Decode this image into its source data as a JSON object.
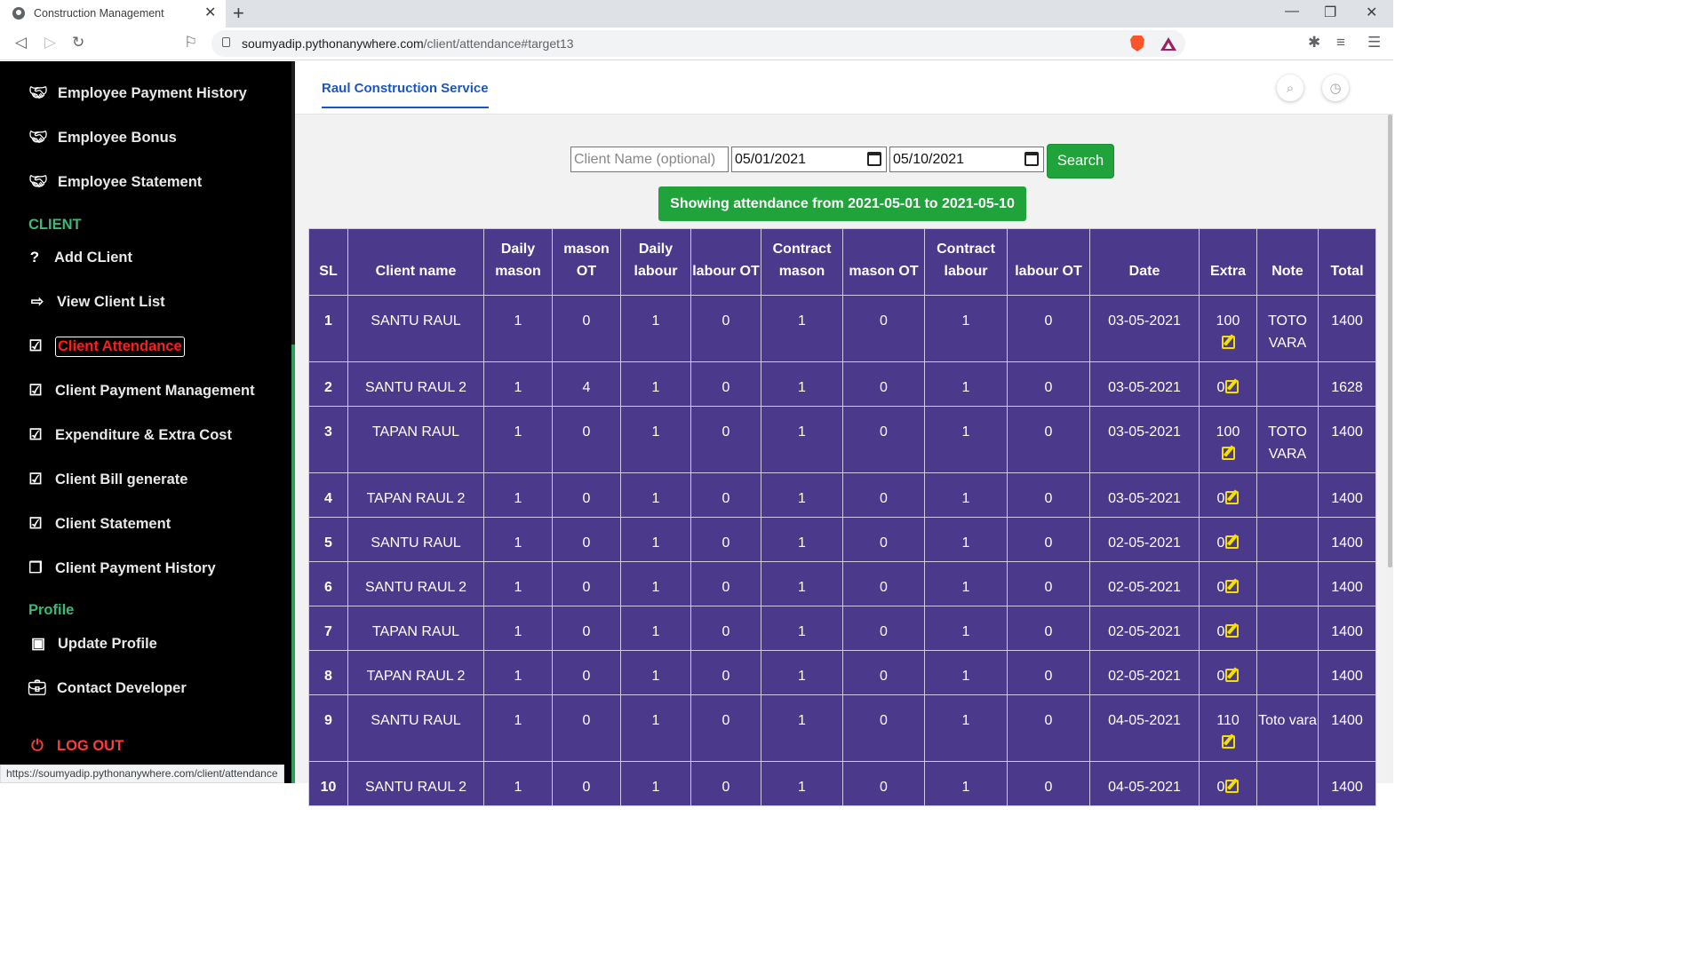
{
  "browser": {
    "tab_title": "Construction Management",
    "url_host": "soumyadip.pythonanywhere.com",
    "url_path": "/client/attendance#target13",
    "status_url": "https://soumyadip.pythonanywhere.com/client/attendance"
  },
  "sidebar": {
    "items_top": [
      {
        "label": "Employee Payment History",
        "icon": "handshake-icon"
      },
      {
        "label": "Employee Bonus",
        "icon": "handshake-icon"
      },
      {
        "label": "Employee Statement",
        "icon": "handshake-icon"
      }
    ],
    "section_client": "CLIENT",
    "client_items": [
      {
        "label": "Add CLient",
        "icon": "question-icon"
      },
      {
        "label": "View Client List",
        "icon": "sign-in-icon"
      },
      {
        "label": "Client Attendance",
        "icon": "calendar-check-icon",
        "active": true
      },
      {
        "label": "Client Payment Management",
        "icon": "calendar-check-icon"
      },
      {
        "label": "Expenditure & Extra Cost",
        "icon": "calendar-check-icon"
      },
      {
        "label": "Client Bill generate",
        "icon": "calendar-check-icon"
      },
      {
        "label": "Client Statement",
        "icon": "calendar-check-icon"
      },
      {
        "label": "Client Payment History",
        "icon": "copy-icon"
      }
    ],
    "section_profile": "Profile",
    "profile_items": [
      {
        "label": "Update Profile",
        "icon": "money-bill-icon"
      },
      {
        "label": "Contact Developer",
        "icon": "briefcase-icon"
      }
    ],
    "logout": "LOG OUT"
  },
  "header": {
    "brand": "Raul Construction Service"
  },
  "filters": {
    "client_placeholder": "Client Name (optional)",
    "from_date": "05/01/2021",
    "to_date": "05/10/2021",
    "search_label": "Search"
  },
  "banner": "Showing attendance from 2021-05-01 to 2021-05-10",
  "table": {
    "columns": [
      "SL",
      "Client name",
      "Daily mason",
      "mason OT",
      "Daily labour",
      "labour OT",
      "Contract mason",
      "mason OT",
      "Contract labour",
      "labour OT",
      "Date",
      "Extra",
      "Note",
      "Total"
    ],
    "rows": [
      {
        "sl": "1",
        "client": "SANTU RAUL",
        "dm": "1",
        "mot": "0",
        "dl": "1",
        "lot": "0",
        "cm": "1",
        "cmot": "0",
        "cl": "1",
        "clot": "0",
        "date": "03-05-2021",
        "extra": "100",
        "note": "TOTO VARA",
        "total": "1400"
      },
      {
        "sl": "2",
        "client": "SANTU RAUL 2",
        "dm": "1",
        "mot": "4",
        "dl": "1",
        "lot": "0",
        "cm": "1",
        "cmot": "0",
        "cl": "1",
        "clot": "0",
        "date": "03-05-2021",
        "extra": "0",
        "note": "",
        "total": "1628"
      },
      {
        "sl": "3",
        "client": "TAPAN RAUL",
        "dm": "1",
        "mot": "0",
        "dl": "1",
        "lot": "0",
        "cm": "1",
        "cmot": "0",
        "cl": "1",
        "clot": "0",
        "date": "03-05-2021",
        "extra": "100",
        "note": "TOTO VARA",
        "total": "1400"
      },
      {
        "sl": "4",
        "client": "TAPAN RAUL 2",
        "dm": "1",
        "mot": "0",
        "dl": "1",
        "lot": "0",
        "cm": "1",
        "cmot": "0",
        "cl": "1",
        "clot": "0",
        "date": "03-05-2021",
        "extra": "0",
        "note": "",
        "total": "1400"
      },
      {
        "sl": "5",
        "client": "SANTU RAUL",
        "dm": "1",
        "mot": "0",
        "dl": "1",
        "lot": "0",
        "cm": "1",
        "cmot": "0",
        "cl": "1",
        "clot": "0",
        "date": "02-05-2021",
        "extra": "0",
        "note": "",
        "total": "1400"
      },
      {
        "sl": "6",
        "client": "SANTU RAUL 2",
        "dm": "1",
        "mot": "0",
        "dl": "1",
        "lot": "0",
        "cm": "1",
        "cmot": "0",
        "cl": "1",
        "clot": "0",
        "date": "02-05-2021",
        "extra": "0",
        "note": "",
        "total": "1400"
      },
      {
        "sl": "7",
        "client": "TAPAN RAUL",
        "dm": "1",
        "mot": "0",
        "dl": "1",
        "lot": "0",
        "cm": "1",
        "cmot": "0",
        "cl": "1",
        "clot": "0",
        "date": "02-05-2021",
        "extra": "0",
        "note": "",
        "total": "1400"
      },
      {
        "sl": "8",
        "client": "TAPAN RAUL 2",
        "dm": "1",
        "mot": "0",
        "dl": "1",
        "lot": "0",
        "cm": "1",
        "cmot": "0",
        "cl": "1",
        "clot": "0",
        "date": "02-05-2021",
        "extra": "0",
        "note": "",
        "total": "1400"
      },
      {
        "sl": "9",
        "client": "SANTU RAUL",
        "dm": "1",
        "mot": "0",
        "dl": "1",
        "lot": "0",
        "cm": "1",
        "cmot": "0",
        "cl": "1",
        "clot": "0",
        "date": "04-05-2021",
        "extra": "110",
        "note": "Toto vara",
        "total": "1400"
      },
      {
        "sl": "10",
        "client": "SANTU RAUL 2",
        "dm": "1",
        "mot": "0",
        "dl": "1",
        "lot": "0",
        "cm": "1",
        "cmot": "0",
        "cl": "1",
        "clot": "0",
        "date": "04-05-2021",
        "extra": "0",
        "note": "",
        "total": "1400"
      }
    ]
  }
}
